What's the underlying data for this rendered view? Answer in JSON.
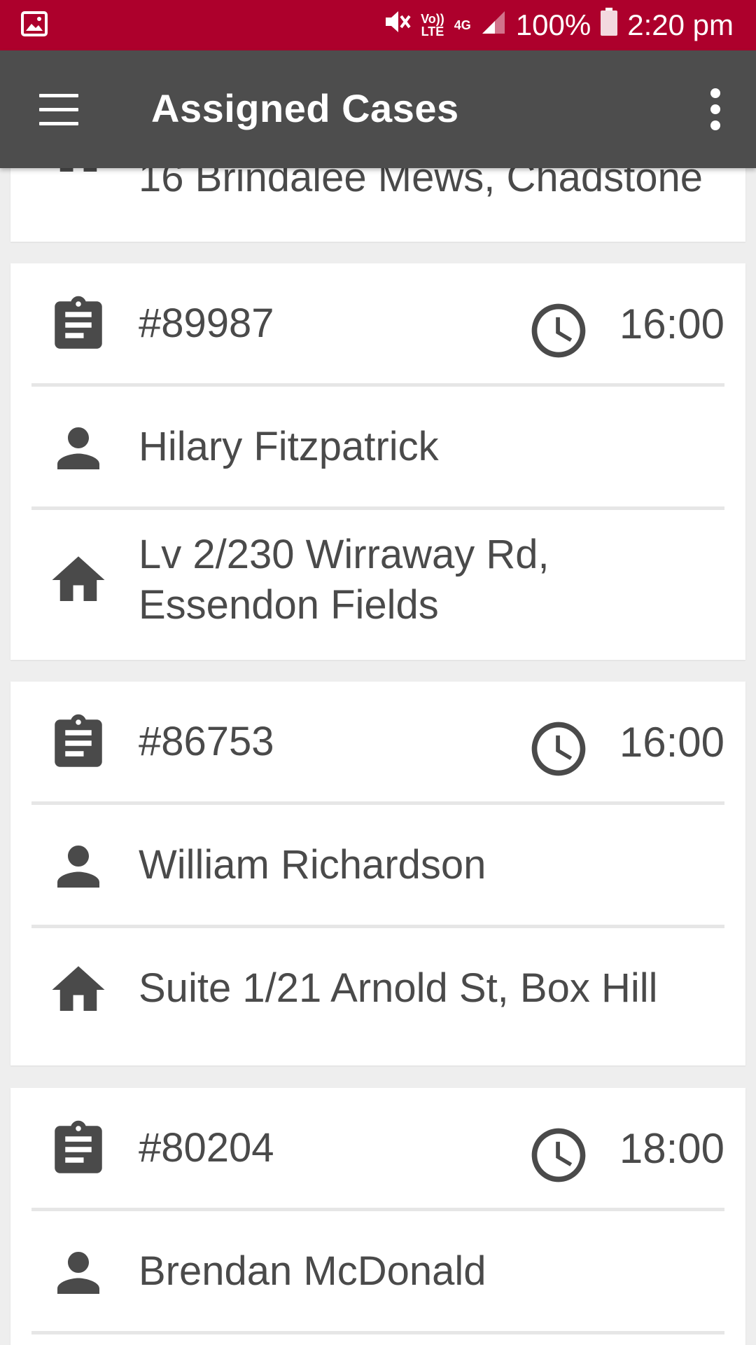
{
  "status_bar": {
    "volte_top": "Vo))",
    "volte_bottom": "LTE",
    "network": "4G",
    "battery": "100%",
    "time": "2:20 pm"
  },
  "toolbar": {
    "title": "Assigned Cases"
  },
  "partial_card": {
    "address": "16 Brindalee Mews, Chadstone"
  },
  "cases": [
    {
      "number": "#89987",
      "time": "16:00",
      "name": "Hilary Fitzpatrick",
      "address": "Lv 2/230 Wirraway Rd, Essendon Fields"
    },
    {
      "number": "#86753",
      "time": "16:00",
      "name": "William Richardson",
      "address": "Suite 1/21 Arnold St, Box Hill"
    },
    {
      "number": "#80204",
      "time": "18:00",
      "name": "Brendan McDonald",
      "address": ""
    }
  ],
  "colors": {
    "status_bar": "#ad002c",
    "toolbar": "#4d4d4d",
    "icon": "#4a4a4a",
    "background": "#eeeeee"
  }
}
